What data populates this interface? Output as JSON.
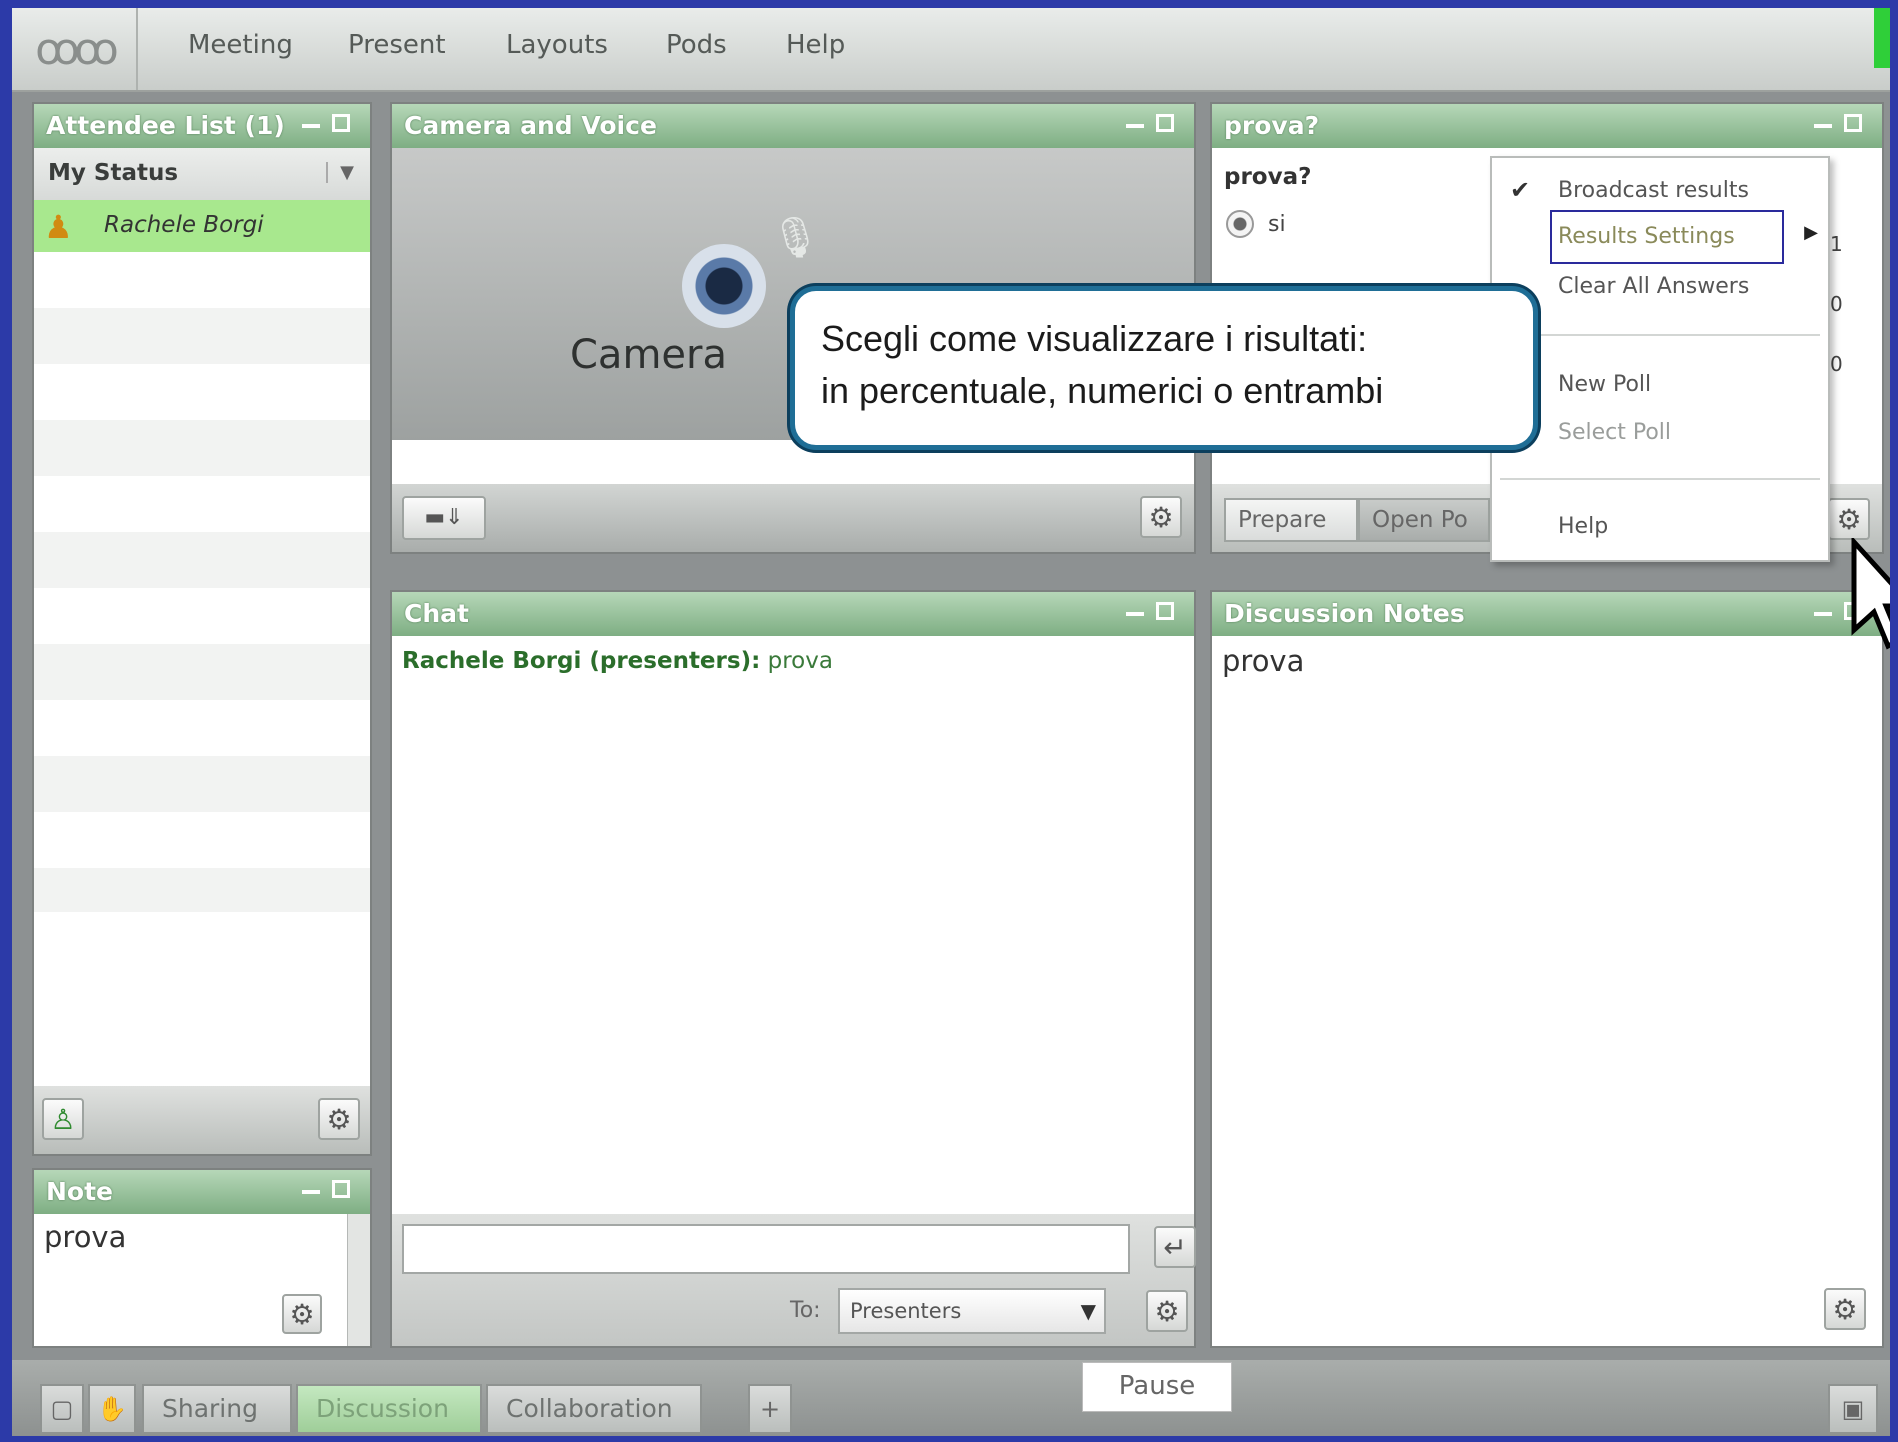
{
  "menubar": {
    "logo": "ꝏꝏ",
    "items": [
      "Meeting",
      "Present",
      "Layouts",
      "Pods",
      "Help"
    ]
  },
  "attendee": {
    "title": "Attendee List (1)",
    "status_label": "My Status",
    "attendees": [
      {
        "name": "Rachele Borgi"
      }
    ]
  },
  "note": {
    "title": "Note",
    "text": "prova"
  },
  "camera": {
    "title": "Camera and Voice",
    "label": "Camera"
  },
  "poll": {
    "title": "prova?",
    "question": "prova?",
    "option": "si",
    "counts": [
      "1",
      "0",
      "0"
    ],
    "tab_prepare": "Prepare",
    "tab_open": "Open Po"
  },
  "context_menu": {
    "broadcast": "Broadcast results",
    "results_settings": "Results Settings",
    "clear_all": "Clear All Answers",
    "new_poll": "New Poll",
    "select_poll": "Select Poll",
    "help": "Help"
  },
  "callout": {
    "line1": "Scegli come visualizzare i risultati:",
    "line2": "in percentuale, numerici o entrambi"
  },
  "chat": {
    "title": "Chat",
    "sender": "Rachele Borgi (presenters):",
    "message": "prova",
    "to_label": "To:",
    "to_value": "Presenters"
  },
  "discussion": {
    "title": "Discussion Notes",
    "text": "prova"
  },
  "bottombar": {
    "tabs": [
      "Sharing",
      "Discussion",
      "Collaboration"
    ],
    "add": "+",
    "pause": "Pause"
  }
}
